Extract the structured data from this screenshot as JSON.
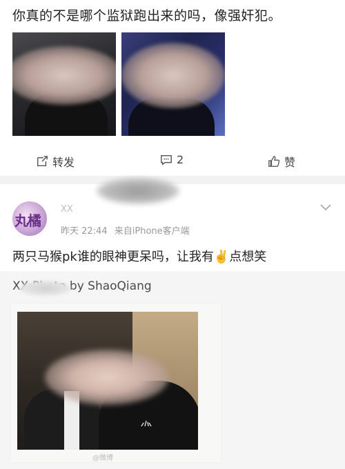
{
  "post1": {
    "text": "你真的不是哪个监狱跑出来的吗，像强奸犯。",
    "actions": {
      "repost_label": "转发",
      "comment_count": "2",
      "like_label": "赞"
    }
  },
  "post2": {
    "avatar_text": "丸橘",
    "username": "XX",
    "time": "昨天 22:44",
    "source": "来自iPhone客户端",
    "text": "两只马猴pk谁的眼神更呆吗，让我有✌️点想笑",
    "repost_credit": "XX:Photo by ShaoQiang",
    "watermark": "@微博"
  },
  "colors": {
    "separator": "#f2f2f2",
    "repost_bg": "#f5f5f5",
    "avatar_text": "#6a2f8a"
  }
}
